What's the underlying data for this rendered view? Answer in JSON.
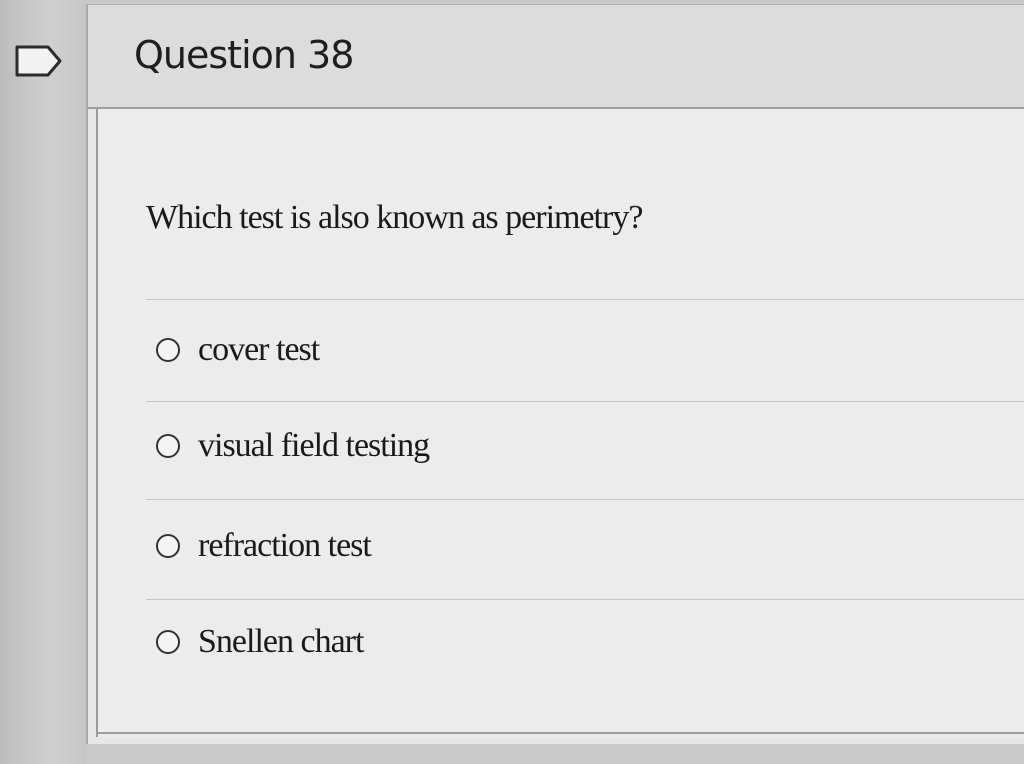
{
  "question": {
    "title": "Question 38",
    "prompt": "Which test is also known as perimetry?",
    "options": [
      {
        "label": "cover test",
        "selected": false
      },
      {
        "label": "visual field testing",
        "selected": false
      },
      {
        "label": "refraction test",
        "selected": false
      },
      {
        "label": "Snellen chart",
        "selected": false
      }
    ]
  },
  "icons": {
    "flag": "flag-icon"
  }
}
